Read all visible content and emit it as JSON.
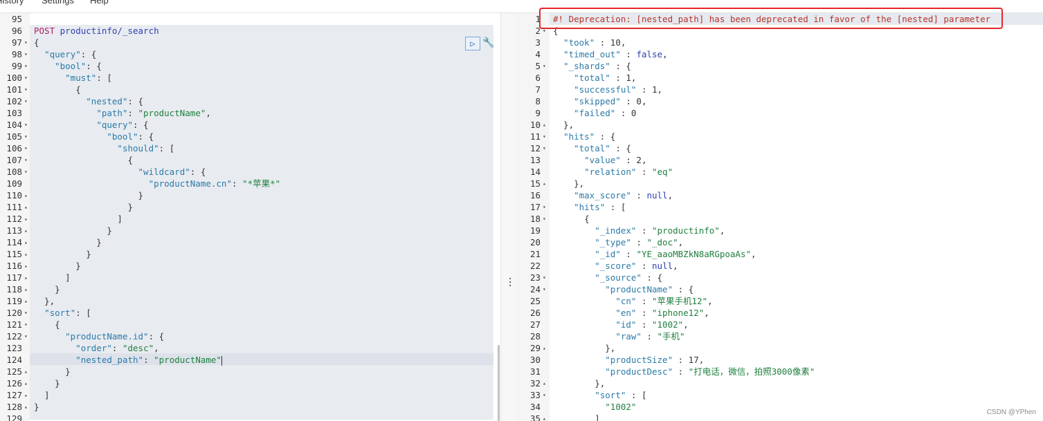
{
  "menu": [
    "History",
    "Settings",
    "Help"
  ],
  "request": {
    "method": "POST",
    "path": "productinfo/_search",
    "lines": [
      {
        "n": "95",
        "fold": "",
        "t": ""
      },
      {
        "n": "96",
        "fold": "",
        "t": "POST productinfo/_search"
      },
      {
        "n": "97",
        "fold": "▾",
        "t": "{"
      },
      {
        "n": "98",
        "fold": "▾",
        "t": "  \"query\": {"
      },
      {
        "n": "99",
        "fold": "▾",
        "t": "    \"bool\": {"
      },
      {
        "n": "100",
        "fold": "▾",
        "t": "      \"must\": ["
      },
      {
        "n": "101",
        "fold": "▾",
        "t": "        {"
      },
      {
        "n": "102",
        "fold": "▾",
        "t": "          \"nested\": {"
      },
      {
        "n": "103",
        "fold": "",
        "t": "            \"path\": \"productName\","
      },
      {
        "n": "104",
        "fold": "▾",
        "t": "            \"query\": {"
      },
      {
        "n": "105",
        "fold": "▾",
        "t": "              \"bool\": {"
      },
      {
        "n": "106",
        "fold": "▾",
        "t": "                \"should\": ["
      },
      {
        "n": "107",
        "fold": "▾",
        "t": "                  {"
      },
      {
        "n": "108",
        "fold": "▾",
        "t": "                    \"wildcard\": {"
      },
      {
        "n": "109",
        "fold": "",
        "t": "                      \"productName.cn\": \"*苹果*\""
      },
      {
        "n": "110",
        "fold": "▴",
        "t": "                    }"
      },
      {
        "n": "111",
        "fold": "▴",
        "t": "                  }"
      },
      {
        "n": "112",
        "fold": "▴",
        "t": "                ]"
      },
      {
        "n": "113",
        "fold": "▴",
        "t": "              }"
      },
      {
        "n": "114",
        "fold": "▴",
        "t": "            }"
      },
      {
        "n": "115",
        "fold": "▴",
        "t": "          }"
      },
      {
        "n": "116",
        "fold": "▴",
        "t": "        }"
      },
      {
        "n": "117",
        "fold": "▴",
        "t": "      ]"
      },
      {
        "n": "118",
        "fold": "▴",
        "t": "    }"
      },
      {
        "n": "119",
        "fold": "▴",
        "t": "  },"
      },
      {
        "n": "120",
        "fold": "▾",
        "t": "  \"sort\": ["
      },
      {
        "n": "121",
        "fold": "▾",
        "t": "    {"
      },
      {
        "n": "122",
        "fold": "▾",
        "t": "      \"productName.id\": {"
      },
      {
        "n": "123",
        "fold": "",
        "t": "        \"order\": \"desc\","
      },
      {
        "n": "124",
        "fold": "",
        "t": "        \"nested_path\": \"productName\""
      },
      {
        "n": "125",
        "fold": "▴",
        "t": "      }"
      },
      {
        "n": "126",
        "fold": "▴",
        "t": "    }"
      },
      {
        "n": "127",
        "fold": "▴",
        "t": "  ]"
      },
      {
        "n": "128",
        "fold": "▴",
        "t": "}"
      },
      {
        "n": "129",
        "fold": "",
        "t": ""
      }
    ]
  },
  "response": {
    "warning": "#! Deprecation: [nested_path] has been deprecated in favor of the [nested] parameter",
    "lines": [
      {
        "n": "1",
        "fold": "",
        "t": "#! Deprecation: [nested_path] has been deprecated in favor of the [nested] parameter"
      },
      {
        "n": "2",
        "fold": "▾",
        "t": "{"
      },
      {
        "n": "3",
        "fold": "",
        "t": "  \"took\" : 10,"
      },
      {
        "n": "4",
        "fold": "",
        "t": "  \"timed_out\" : false,"
      },
      {
        "n": "5",
        "fold": "▾",
        "t": "  \"_shards\" : {"
      },
      {
        "n": "6",
        "fold": "",
        "t": "    \"total\" : 1,"
      },
      {
        "n": "7",
        "fold": "",
        "t": "    \"successful\" : 1,"
      },
      {
        "n": "8",
        "fold": "",
        "t": "    \"skipped\" : 0,"
      },
      {
        "n": "9",
        "fold": "",
        "t": "    \"failed\" : 0"
      },
      {
        "n": "10",
        "fold": "▴",
        "t": "  },"
      },
      {
        "n": "11",
        "fold": "▾",
        "t": "  \"hits\" : {"
      },
      {
        "n": "12",
        "fold": "▾",
        "t": "    \"total\" : {"
      },
      {
        "n": "13",
        "fold": "",
        "t": "      \"value\" : 2,"
      },
      {
        "n": "14",
        "fold": "",
        "t": "      \"relation\" : \"eq\""
      },
      {
        "n": "15",
        "fold": "▴",
        "t": "    },"
      },
      {
        "n": "16",
        "fold": "",
        "t": "    \"max_score\" : null,"
      },
      {
        "n": "17",
        "fold": "▾",
        "t": "    \"hits\" : ["
      },
      {
        "n": "18",
        "fold": "▾",
        "t": "      {"
      },
      {
        "n": "19",
        "fold": "",
        "t": "        \"_index\" : \"productinfo\","
      },
      {
        "n": "20",
        "fold": "",
        "t": "        \"_type\" : \"_doc\","
      },
      {
        "n": "21",
        "fold": "",
        "t": "        \"_id\" : \"YE_aaoMBZkN8aRGpoaAs\","
      },
      {
        "n": "22",
        "fold": "",
        "t": "        \"_score\" : null,"
      },
      {
        "n": "23",
        "fold": "▾",
        "t": "        \"_source\" : {"
      },
      {
        "n": "24",
        "fold": "▾",
        "t": "          \"productName\" : {"
      },
      {
        "n": "25",
        "fold": "",
        "t": "            \"cn\" : \"苹果手机12\","
      },
      {
        "n": "26",
        "fold": "",
        "t": "            \"en\" : \"iphone12\","
      },
      {
        "n": "27",
        "fold": "",
        "t": "            \"id\" : \"1002\","
      },
      {
        "n": "28",
        "fold": "",
        "t": "            \"raw\" : \"手机\""
      },
      {
        "n": "29",
        "fold": "▴",
        "t": "          },"
      },
      {
        "n": "30",
        "fold": "",
        "t": "          \"productSize\" : 17,"
      },
      {
        "n": "31",
        "fold": "",
        "t": "          \"productDesc\" : \"打电话，微信，拍照3000像素\""
      },
      {
        "n": "32",
        "fold": "▴",
        "t": "        },"
      },
      {
        "n": "33",
        "fold": "▾",
        "t": "        \"sort\" : ["
      },
      {
        "n": "34",
        "fold": "",
        "t": "          \"1002\""
      },
      {
        "n": "35",
        "fold": "▴",
        "t": "        ]"
      }
    ]
  },
  "watermark": "CSDN @YPhen",
  "icons": {
    "run": "play-icon",
    "settings": "wrench-icon",
    "resize": "drag-handle-icon"
  }
}
